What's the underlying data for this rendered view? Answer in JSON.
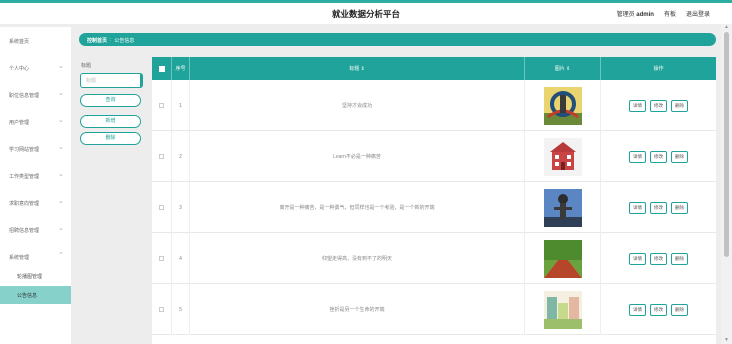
{
  "header": {
    "title": "就业数据分析平台",
    "user_role": "管理员",
    "username": "admin",
    "link_front": "有板",
    "link_logout": "退出登录"
  },
  "sidebar": {
    "items": [
      {
        "label": "系统首页",
        "has_chevron": false
      },
      {
        "label": "个人中心",
        "has_chevron": true
      },
      {
        "label": "职位信息管理",
        "has_chevron": true
      },
      {
        "label": "用户管理",
        "has_chevron": true
      },
      {
        "label": "学习网站管理",
        "has_chevron": true
      },
      {
        "label": "工作类型管理",
        "has_chevron": true
      },
      {
        "label": "求职意向管理",
        "has_chevron": true
      },
      {
        "label": "招聘信息管理",
        "has_chevron": true
      },
      {
        "label": "系统管理",
        "has_chevron": true,
        "expanded": true
      }
    ],
    "subitems": [
      {
        "label": "轮播图管理",
        "active": false
      },
      {
        "label": "公告信息",
        "active": true
      }
    ]
  },
  "breadcrumb": {
    "home": "控制首页",
    "separator": ":",
    "current": "公告信息"
  },
  "search": {
    "label": "标题",
    "placeholder": "标题",
    "query_button": "查询",
    "add_button": "新增",
    "delete_button": "删除"
  },
  "table": {
    "columns": {
      "index": "序号",
      "title": "标题 ⇕",
      "image": "图片 ⇕",
      "actions": "操作"
    },
    "action_labels": {
      "detail": "详情",
      "edit": "修改",
      "delete": "删除"
    },
    "rows": [
      {
        "index": "1",
        "title": "坚持才会成功",
        "image": "bridge-sculpture"
      },
      {
        "index": "2",
        "title": "Learn不必是一种痛苦",
        "image": "red-building"
      },
      {
        "index": "3",
        "title": "离开是一种痛苦，是一种勇气，但同样也是一个考验，是一个新的开端",
        "image": "statue-blue-sky"
      },
      {
        "index": "4",
        "title": "仰望走得高，没有到不了的明天",
        "image": "tree-lined-road"
      },
      {
        "index": "5",
        "title": "挫折是另一个生命的开端",
        "image": "illustrated-street"
      }
    ]
  },
  "colors": {
    "accent": "#1fa39a",
    "active_nav": "#86d2cb"
  }
}
